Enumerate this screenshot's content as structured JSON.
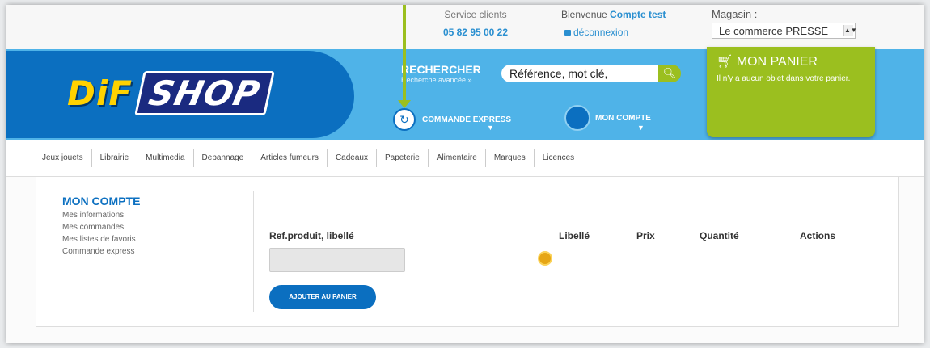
{
  "top": {
    "service_label": "Service clients",
    "service_phone": "05 82 95 00 22",
    "welcome_prefix": "Bienvenue ",
    "welcome_user": "Compte test",
    "logout": "déconnexion",
    "store_label": "Magasin :",
    "store_value": "Le commerce PRESSE"
  },
  "logo": {
    "part1": "DiF",
    "part2": "SHOP"
  },
  "search": {
    "label": "RECHERCHER",
    "sub": "Recherche avancée »",
    "placeholder": "Référence, mot clé,"
  },
  "nav": {
    "express": "COMMANDE EXPRESS",
    "account": "MON COMPTE"
  },
  "cart": {
    "title": "MON PANIER",
    "message": "Il n'y a aucun objet dans votre panier."
  },
  "categories": [
    "Jeux jouets",
    "Librairie",
    "Multimedia",
    "Depannage",
    "Articles fumeurs",
    "Cadeaux",
    "Papeterie",
    "Alimentaire",
    "Marques",
    "Licences"
  ],
  "sidebar": {
    "title": "MON COMPTE",
    "items": [
      "Mes informations",
      "Mes commandes",
      "Mes listes de favoris",
      "Commande express"
    ]
  },
  "form": {
    "ref_label": "Ref.produit, libellé",
    "add_button": "AJOUTER AU PANIER",
    "columns": [
      "Libellé",
      "Prix",
      "Quantité",
      "Actions"
    ]
  },
  "colors": {
    "primary": "#0b6fc0",
    "sky": "#4fb3e8",
    "accent": "#9bbf1f"
  }
}
